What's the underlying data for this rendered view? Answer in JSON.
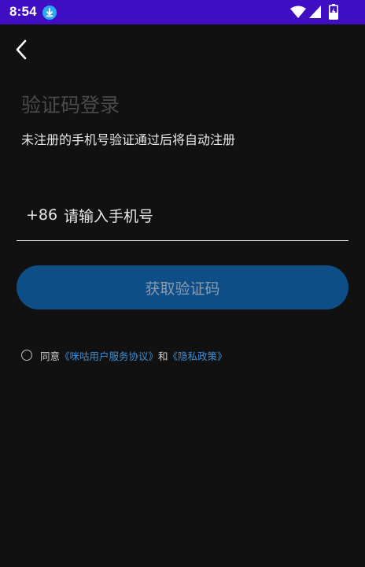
{
  "status_bar": {
    "time": "8:54",
    "icons": [
      "download-icon",
      "wifi-icon",
      "signal-icon",
      "battery-icon"
    ]
  },
  "header": {
    "back_icon": "chevron-left-icon"
  },
  "login": {
    "title": "验证码登录",
    "subtitle": "未注册的手机号验证通过后将自动注册",
    "country_code": "+86",
    "phone_placeholder": "请输入手机号",
    "phone_value": "",
    "get_code_label": "获取验证码"
  },
  "agreement": {
    "prefix": "同意",
    "user_agreement": "《咪咕用户服务协议》",
    "conjunction": "和",
    "privacy_policy": "《隐私政策》",
    "checked": false
  },
  "colors": {
    "status_bar": "#3f0ec2",
    "background": "#111111",
    "button": "#0d4e86",
    "link": "#3d8fd6"
  }
}
